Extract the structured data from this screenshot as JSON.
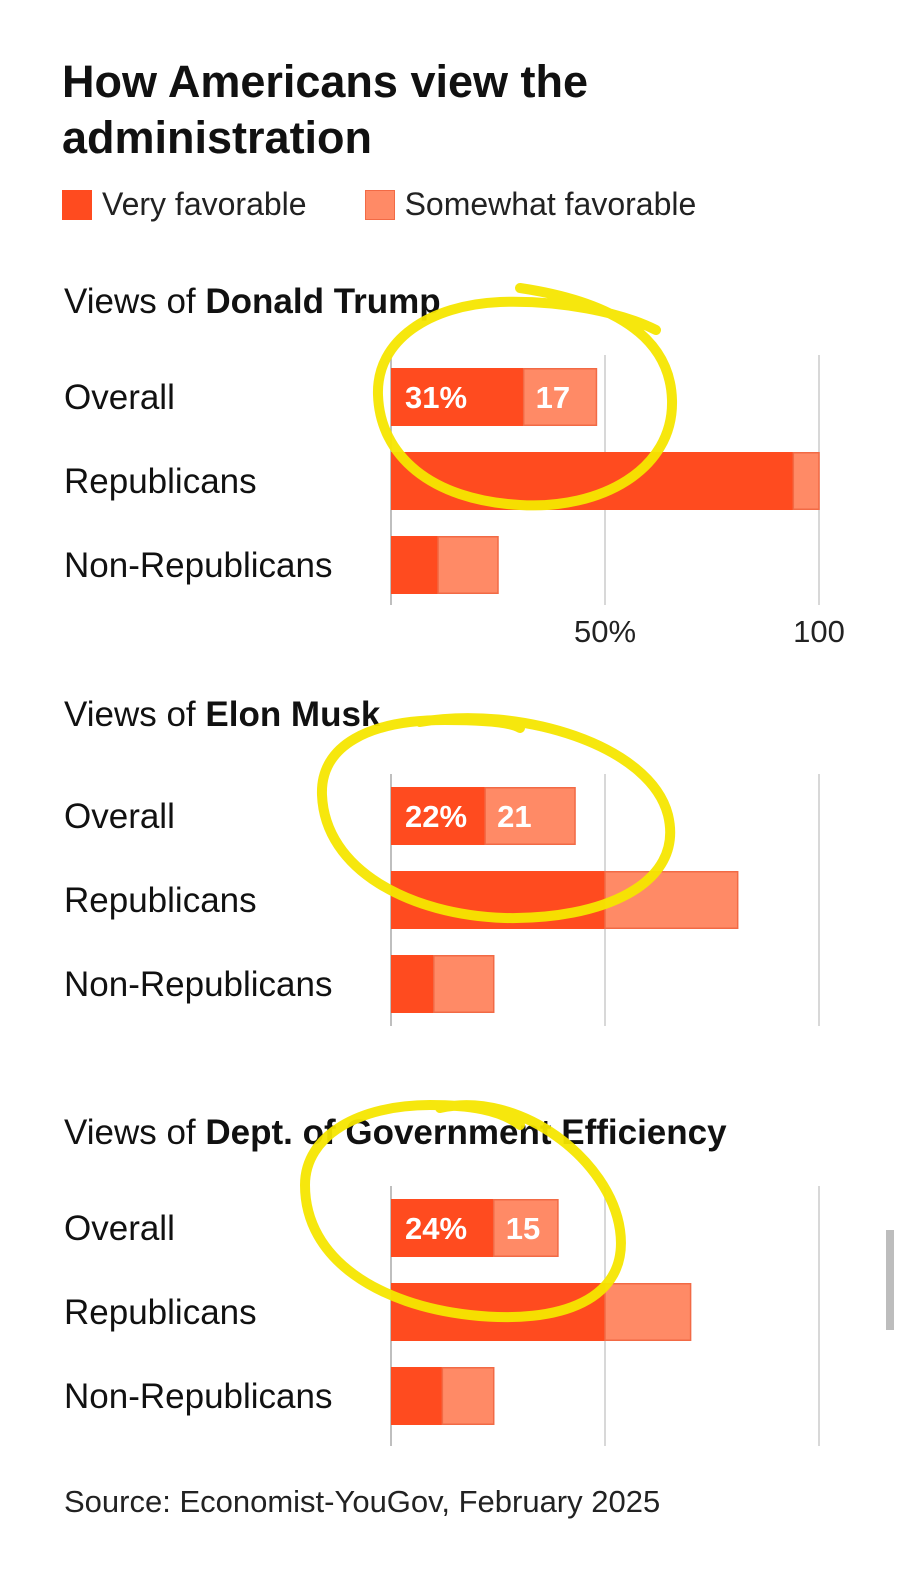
{
  "title": "How Americans view the administration",
  "legend": {
    "very": "Very favorable",
    "somewhat": "Somewhat favorable"
  },
  "colors": {
    "very": "#ff4b1f",
    "somewhat": "#ff8a66",
    "grid": "#cccccc",
    "annotation": "#f5e600"
  },
  "source": "Source: Economist-YouGov, February 2025",
  "chart_data": [
    {
      "type": "bar",
      "orientation": "horizontal",
      "stacked": true,
      "title_prefix": "Views of ",
      "title": "Donald Trump",
      "categories": [
        "Overall",
        "Republicans",
        "Non-Republicans"
      ],
      "series": [
        {
          "name": "Very favorable",
          "values": [
            31,
            94,
            11
          ]
        },
        {
          "name": "Somewhat favorable",
          "values": [
            17,
            6,
            14
          ]
        }
      ],
      "data_labels": [
        "31%",
        "17"
      ],
      "xlim": [
        0,
        100
      ],
      "xticks": [
        "50%",
        "100"
      ],
      "grid": true
    },
    {
      "type": "bar",
      "orientation": "horizontal",
      "stacked": true,
      "title_prefix": "Views of ",
      "title": "Elon Musk",
      "categories": [
        "Overall",
        "Republicans",
        "Non-Republicans"
      ],
      "series": [
        {
          "name": "Very favorable",
          "values": [
            22,
            50,
            10
          ]
        },
        {
          "name": "Somewhat favorable",
          "values": [
            21,
            31,
            14
          ]
        }
      ],
      "data_labels": [
        "22%",
        "21"
      ],
      "xlim": [
        0,
        100
      ],
      "grid": true
    },
    {
      "type": "bar",
      "orientation": "horizontal",
      "stacked": true,
      "title_prefix": "Views of ",
      "title": "Dept. of Government Efficiency",
      "categories": [
        "Overall",
        "Republicans",
        "Non-Republicans"
      ],
      "series": [
        {
          "name": "Very favorable",
          "values": [
            24,
            50,
            12
          ]
        },
        {
          "name": "Somewhat favorable",
          "values": [
            15,
            20,
            12
          ]
        }
      ],
      "data_labels": [
        "24%",
        "15"
      ],
      "xlim": [
        0,
        100
      ],
      "grid": true
    }
  ]
}
